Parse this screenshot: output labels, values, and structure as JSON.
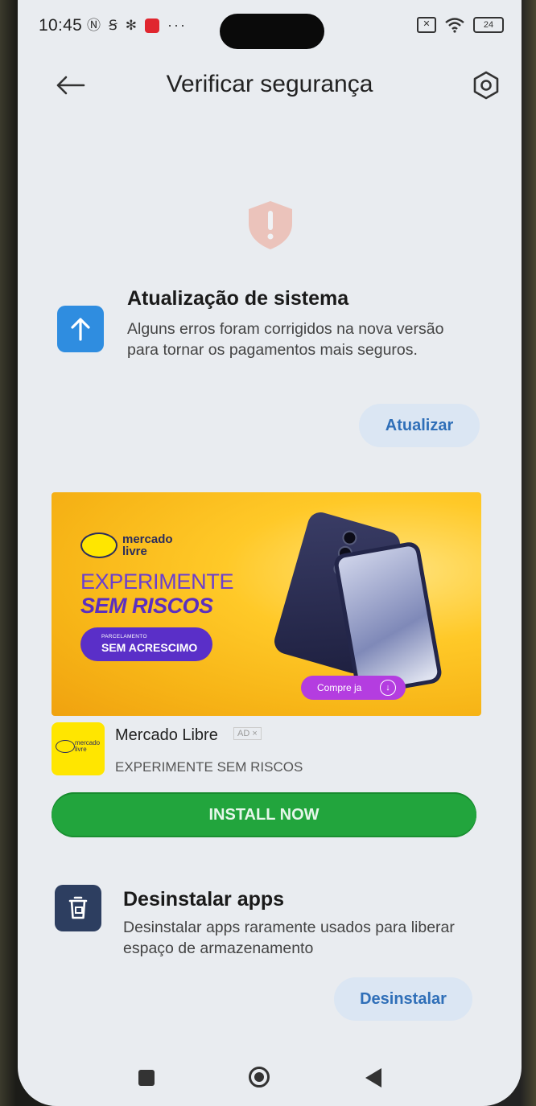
{
  "status_bar": {
    "time": "10:45",
    "left_icons": [
      "nfc-icon",
      "s-icon",
      "gear-icon",
      "mail-red-icon",
      "more-dots-icon"
    ],
    "battery": "24"
  },
  "header": {
    "title": "Verificar segurança"
  },
  "update": {
    "title": "Atualização de sistema",
    "description": "Alguns erros foram corrigidos na nova versão para tornar os pagamentos mais seguros.",
    "button": "Atualizar"
  },
  "ad": {
    "brand_line1": "mercado",
    "brand_line2": "livre",
    "headline1": "EXPERIMENTE",
    "headline2": "SEM RISCOS",
    "pill_small": "PARCELAMENTO",
    "pill_big": "SEM ACRESCIMO",
    "buy_label": "Compre ja",
    "app_name": "Mercado Libre",
    "ad_tag": "AD ×",
    "subtitle": "EXPERIMENTE SEM RISCOS",
    "install_label": "INSTALL NOW"
  },
  "uninstall": {
    "title": "Desinstalar apps",
    "description": "Desinstalar apps raramente usados para liberar espaço de armazenamento",
    "button": "Desinstalar"
  },
  "colors": {
    "screen_bg": "#e9ecf0",
    "accent_blue": "#2f8de0",
    "install_green": "#22a53d",
    "ad_yellow": "#f7b517",
    "ad_purple": "#5a2fc8"
  }
}
